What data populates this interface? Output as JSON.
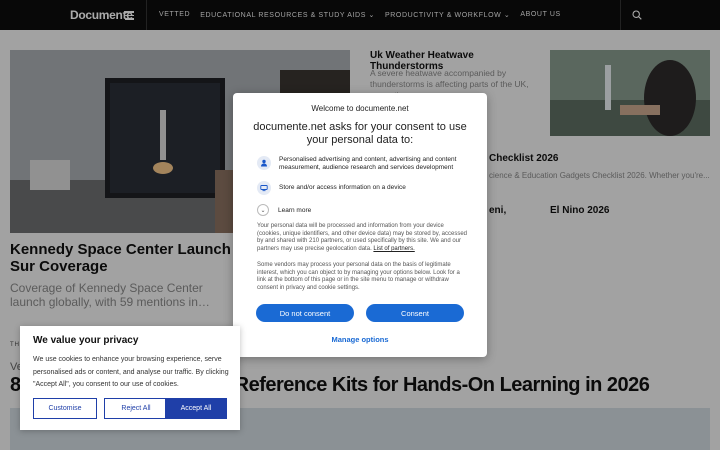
{
  "header": {
    "brand": "Documente",
    "nav": [
      "VETTED",
      "EDUCATIONAL RESOURCES & STUDY AIDS ⌄",
      "PRODUCTIVITY & WORKFLOW ⌄",
      "ABOUT US"
    ]
  },
  "content": {
    "side_title": "Uk Weather Heatwave Thunderstorms",
    "side_summary": "A severe heatwave accompanied by thunderstorms is affecting parts of the UK, prompting",
    "frag_checklist_title": "Checklist 2026",
    "frag_checklist_summary": "cience & Education Gadgets Checklist 2026. Whether you're...",
    "frag_eni": "eni,",
    "frag_elnino": "El Nino 2026",
    "hero_title": "Kennedy Space Center Launch Sur Coverage",
    "hero_summary": "Coverage of Kennedy Space Center launch globally, with 59 mentions in…",
    "tag": "THE",
    "frag_v": "Ve",
    "big_title": "8 Reference Kits for Hands-On Learning in 2026",
    "big_title_visible": "Reference Kits for Hands-On Learning in 2026",
    "big_title_lead": "8"
  },
  "consent": {
    "welcome": "Welcome to documente.net",
    "heading": "documente.net asks for your consent to use your personal data to:",
    "purposes": [
      {
        "icon": "person-icon",
        "text": "Personalised advertising and content, advertising and content measurement, audience research and services development"
      },
      {
        "icon": "device-icon",
        "text": "Store and/or access information on a device"
      }
    ],
    "learn_more": "Learn more",
    "body1": "Your personal data will be processed and information from your device (cookies, unique identifiers, and other device data) may be stored by, accessed by and shared with 210 partners, or used specifically by this site. We and our partners may use precise geolocation data.",
    "partners_link": "List of partners.",
    "body2": "Some vendors may process your personal data on the basis of legitimate interest, which you can object to by managing your options below. Look for a link at the bottom of this page or in the site menu to manage or withdraw consent in privacy and cookie settings.",
    "do_not_consent": "Do not consent",
    "consent": "Consent",
    "manage_options": "Manage options",
    "accent": "#1a6ad4"
  },
  "cookie": {
    "title": "We value your privacy",
    "text": "We use cookies to enhance your browsing experience, serve personalised ads or content, and analyse our traffic. By clicking \"Accept All\", you consent to our use of cookies.",
    "customise": "Customise",
    "reject_all": "Reject All",
    "accept_all": "Accept All",
    "accent": "#1f3fa8"
  }
}
